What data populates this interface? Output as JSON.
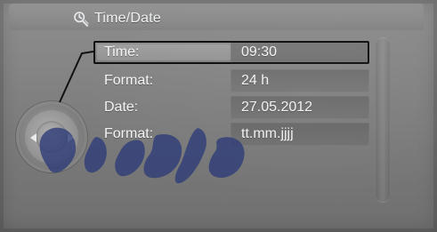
{
  "header": {
    "title": "Time/Date"
  },
  "settings": {
    "rows": [
      {
        "label": "Time:",
        "value": "09:30"
      },
      {
        "label": "Format:",
        "value": "24 h"
      },
      {
        "label": "Date:",
        "value": "27.05.2012"
      },
      {
        "label": "Format:",
        "value": "tt.mm.jjjj"
      }
    ]
  },
  "ui": {
    "icons": {
      "header": "clock-settings-icon",
      "knob_left": "arrow-left-icon",
      "knob_right": "arrow-right-icon"
    },
    "colors": {
      "selected_border": "#111111",
      "text": "#f2f4f5",
      "watermark": "#2f3d78"
    }
  },
  "watermark": {
    "text": "امداد خودرو"
  }
}
